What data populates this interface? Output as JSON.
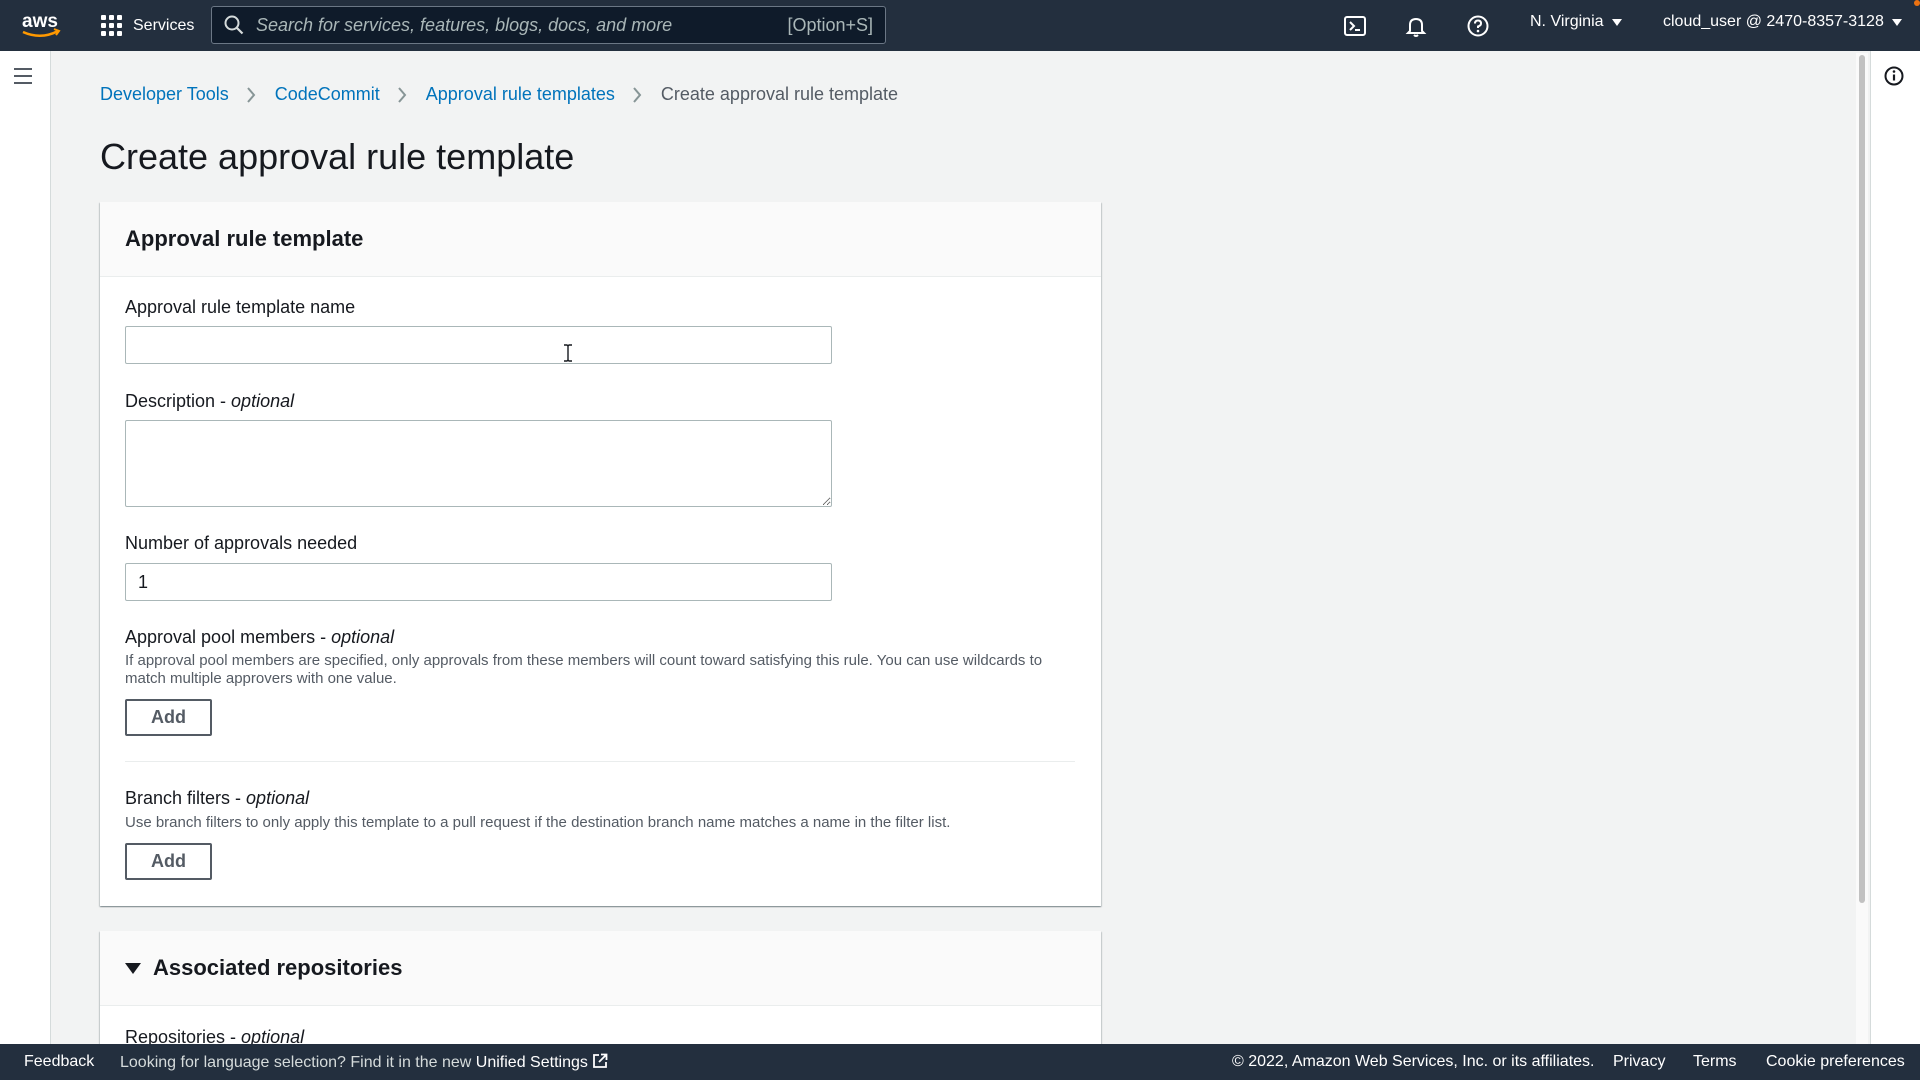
{
  "topnav": {
    "logo_text": "aws",
    "services_label": "Services",
    "search_placeholder": "Search for services, features, blogs, docs, and more",
    "search_shortcut": "[Option+S]",
    "region": "N. Virginia",
    "account": "cloud_user @ 2470-8357-3128",
    "icons": [
      "cloudshell-icon",
      "bell-icon",
      "help-icon"
    ]
  },
  "breadcrumb": {
    "items": [
      "Developer Tools",
      "CodeCommit",
      "Approval rule templates"
    ],
    "current": "Create approval rule template"
  },
  "page_title": "Create approval rule template",
  "panel1": {
    "title": "Approval rule template",
    "name_label": "Approval rule template name",
    "name_value": "",
    "description_label": "Description",
    "description_suffix": "optional",
    "description_value": "",
    "approvals_label": "Number of approvals needed",
    "approvals_value": "1",
    "pool_label": "Approval pool members",
    "pool_suffix": "optional",
    "pool_desc": "If approval pool members are specified, only approvals from these members will count toward satisfying this rule. You can use wildcards to match multiple approvers with one value.",
    "pool_add": "Add",
    "branch_label": "Branch filters",
    "branch_suffix": "optional",
    "branch_desc": "Use branch filters to only apply this template to a pull request if the destination branch name matches a name in the filter list.",
    "branch_add": "Add"
  },
  "panel2": {
    "title": "Associated repositories",
    "repos_label": "Repositories",
    "repos_suffix": "optional"
  },
  "footer": {
    "feedback": "Feedback",
    "lang_text": "Looking for language selection? Find it in the new ",
    "unified_settings": "Unified Settings",
    "copyright": "© 2022, Amazon Web Services, Inc. or its affiliates.",
    "privacy": "Privacy",
    "terms": "Terms",
    "cookie": "Cookie preferences"
  },
  "colors": {
    "nav_bg": "#232f3e",
    "link": "#0073bb",
    "page_bg": "#f2f3f3",
    "notification_dot": "#ec7211"
  }
}
